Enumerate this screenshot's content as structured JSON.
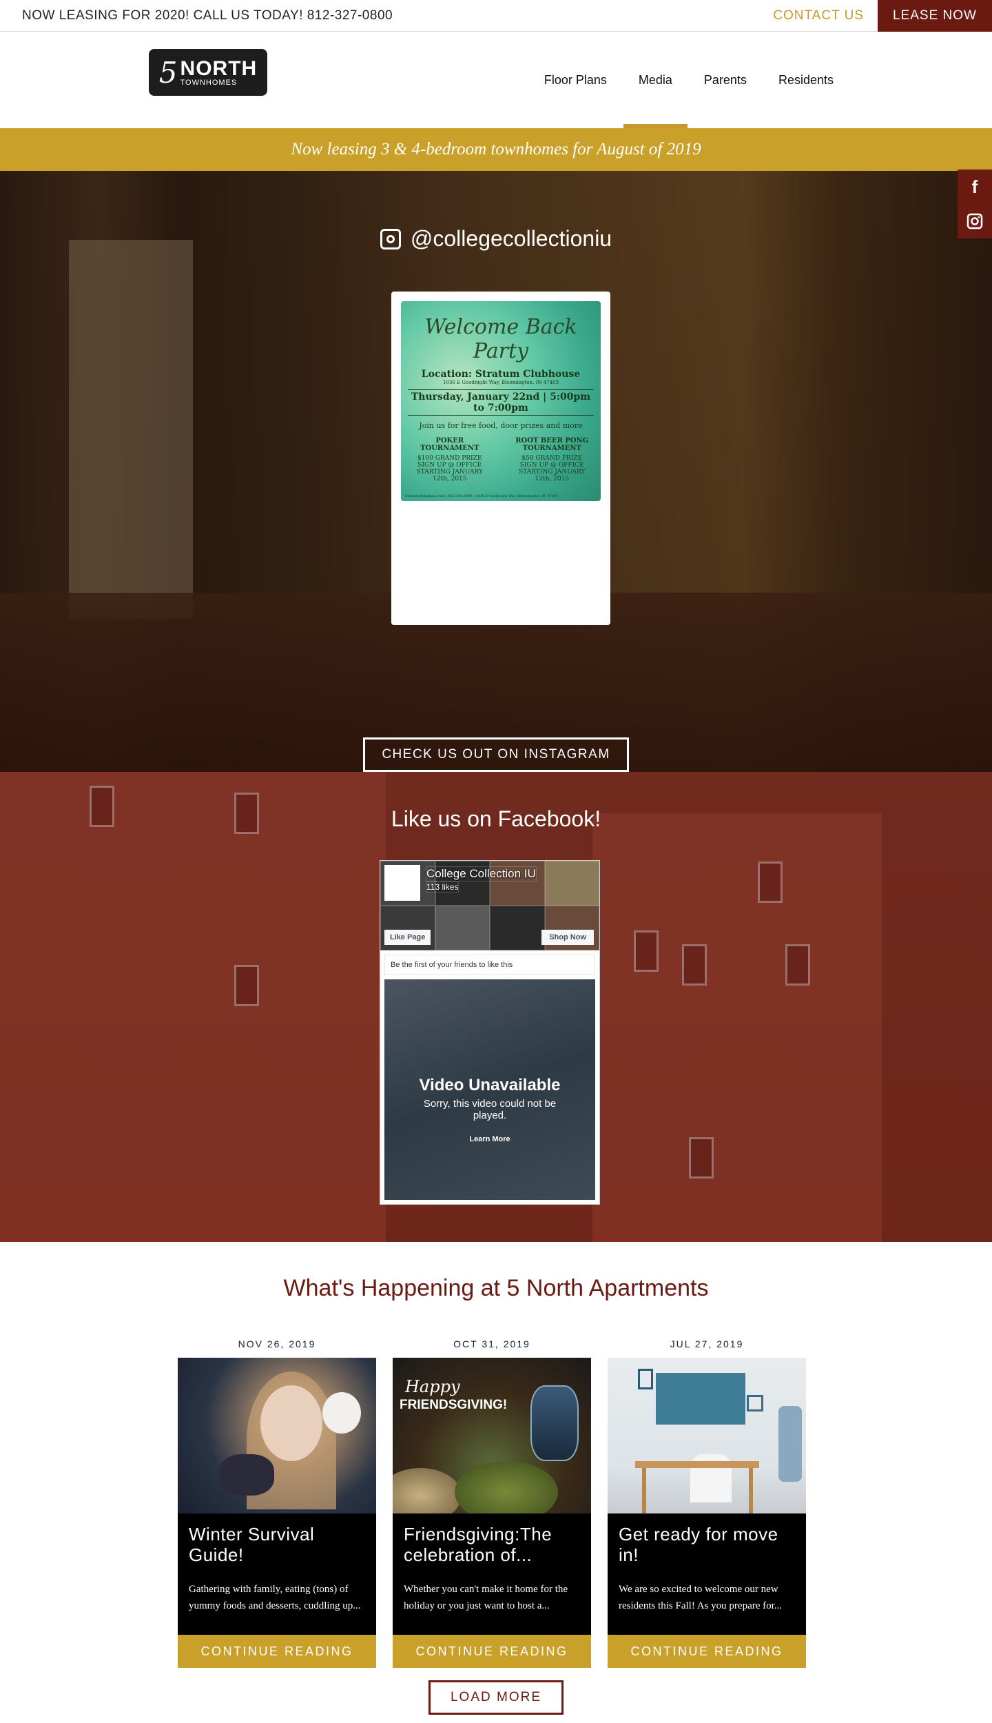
{
  "topbar": {
    "announcement": "NOW LEASING FOR 2020! CALL US TODAY! 812-327-0800",
    "contact_label": "CONTACT US",
    "lease_label": "LEASE NOW"
  },
  "logo": {
    "number": "5",
    "word": "NORTH",
    "sub": "TOWNHOMES"
  },
  "nav": {
    "items": [
      "Floor Plans",
      "Media",
      "Parents",
      "Residents"
    ],
    "active": "Media"
  },
  "banner": {
    "text": "Now leasing 3 & 4-bedroom townhomes for August of 2019"
  },
  "side_social": {
    "facebook_glyph": "f"
  },
  "instagram": {
    "handle": "@collegecollectioniu",
    "post": {
      "title": "Welcome Back Party",
      "location": "Location: Stratum Clubhouse",
      "address": "1036 E Goodnight Way, Bloomington, IN 47403",
      "when": "Thursday, January 22nd | 5:00pm to 7:00pm",
      "invite": "Join us for free food, door prizes and more",
      "events": [
        {
          "name": "POKER TOURNAMENT",
          "prize": "$100 GRAND PRIZE",
          "signup": "SIGN UP @ OFFICE STARTING JANUARY 12th, 2015"
        },
        {
          "name": "ROOT BEER PONG TOURNAMENT",
          "prize": "$50 GRAND PRIZE",
          "signup": "SIGN UP @ OFFICE STARTING JANUARY 12th, 2015"
        }
      ],
      "footer": "StratumAtIndiana.com | 812.334.8868 | 1036 E Goodnight Way, Bloomington, IN 47403"
    },
    "button_label": "CHECK US OUT ON INSTAGRAM"
  },
  "facebook": {
    "heading": "Like us on Facebook!",
    "page_name": "College Collection IU",
    "likes": "113 likes",
    "like_button": "Like Page",
    "shop_button": "Shop Now",
    "friends_text": "Be the first of your friends to like this",
    "video_title": "Video Unavailable",
    "video_subtitle": "Sorry, this video could not be played.",
    "video_link": "Learn More"
  },
  "news": {
    "title": "What's Happening at 5 North Apartments",
    "posts": [
      {
        "date": "NOV 26, 2019",
        "title": "Winter Survival Guide!",
        "excerpt": "Gathering with family, eating (tons) of yummy foods and desserts, cuddling up...",
        "read_label": "CONTINUE READING"
      },
      {
        "date": "OCT 31, 2019",
        "title": "Friendsgiving:The celebration of...",
        "excerpt": "Whether you can't make it home for the holiday or you just want to host a...",
        "read_label": "CONTINUE READING",
        "image_text_1": "Happy",
        "image_text_2": "FRIENDSGIVING!"
      },
      {
        "date": "JUL 27, 2019",
        "title": "Get ready for move in!",
        "excerpt": "We are so excited to welcome our new residents this Fall! As you prepare for...",
        "read_label": "CONTINUE READING"
      }
    ],
    "load_more_label": "LOAD MORE"
  },
  "colors": {
    "maroon": "#6b1a12",
    "gold": "#c9a02a"
  }
}
